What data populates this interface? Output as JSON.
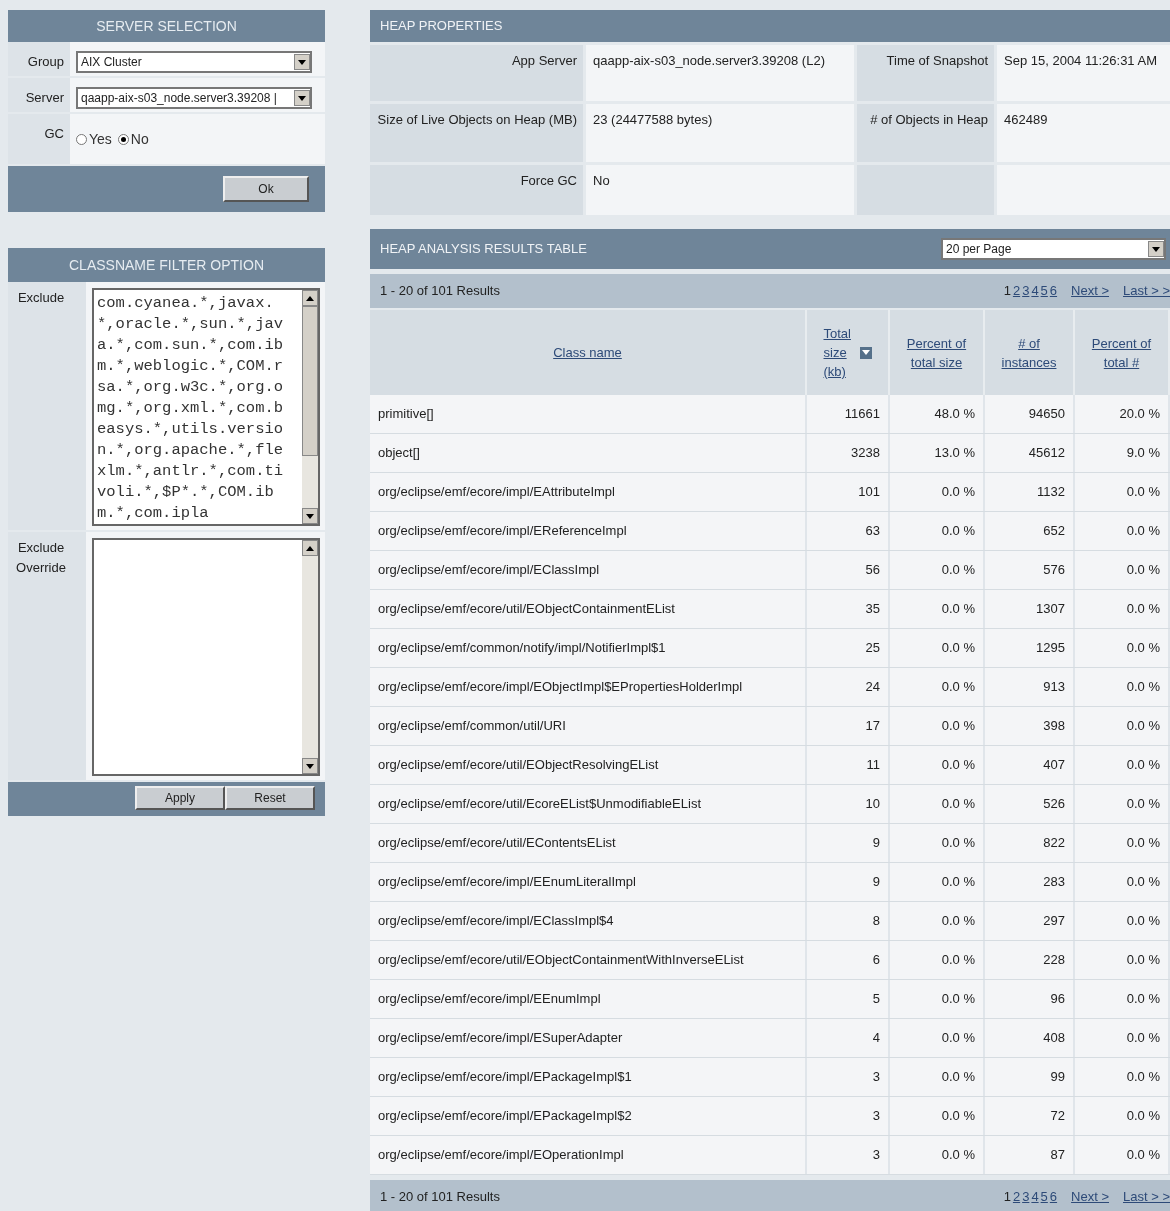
{
  "server_selection": {
    "title": "SERVER SELECTION",
    "group": {
      "label": "Group",
      "value": "AIX Cluster"
    },
    "server": {
      "label": "Server",
      "value": "qaapp-aix-s03_node.server3.39208 |"
    },
    "gc": {
      "label": "GC",
      "options": [
        {
          "label": "Yes",
          "selected": false
        },
        {
          "label": "No",
          "selected": true
        }
      ]
    },
    "ok_button": "Ok"
  },
  "classname_filter": {
    "title": "CLASSNAME FILTER OPTION",
    "exclude": {
      "label": "Exclude",
      "value": "com.cyanea.*,javax.*,oracle.*,sun.*,java.*,com.sun.*,com.ibm.*,weblogic.*,COM.rsa.*,org.w3c.*,org.omg.*,org.xml.*,com.beasys.*,utils.version.*,org.apache.*,flexlm.*,antlr.*,com.tivoli.*,$P*.*,COM.ibm.*,com.ipla"
    },
    "exclude_override": {
      "label": "Exclude Override"
    },
    "buttons": [
      "Apply",
      "Reset"
    ]
  },
  "heap_properties": {
    "title": "HEAP PROPERTIES",
    "rows": [
      [
        {
          "label": "App Server",
          "value": "qaapp-aix-s03_node.server3.39208 (L2)"
        },
        {
          "label": "Time of Snapshot",
          "value": "Sep 15, 2004 11:26:31 AM"
        }
      ],
      [
        {
          "label": "Size of Live Objects on Heap (MB)",
          "value": "23 (24477588 bytes)"
        },
        {
          "label": "# of Objects in Heap",
          "value": "462489"
        }
      ],
      [
        {
          "label": "Force GC",
          "value": "No"
        }
      ]
    ]
  },
  "results_table": {
    "title": "HEAP ANALYSIS RESULTS TABLE",
    "per_page": "20 per Page",
    "top_pager": {
      "summary": "1 - 20 of 101 Results",
      "pages": [
        {
          "label": "1",
          "selected": true
        },
        {
          "label": "2",
          "selected": false
        },
        {
          "label": "3",
          "selected": false
        },
        {
          "label": "4",
          "selected": false
        },
        {
          "label": "5",
          "selected": false
        },
        {
          "label": "6",
          "selected": false
        }
      ],
      "next": "Next >",
      "last": "Last > >"
    },
    "columns": [
      {
        "label": "Class name",
        "sorted": false
      },
      {
        "label": "Total size (kb)",
        "sorted": true
      },
      {
        "label": "Percent of total size",
        "sorted": false
      },
      {
        "label": "# of instances",
        "sorted": false
      },
      {
        "label": "Percent of total #",
        "sorted": false
      }
    ],
    "rows": [
      [
        "primitive[]",
        "11661",
        "48.0 %",
        "94650",
        "20.0 %"
      ],
      [
        "object[]",
        "3238",
        "13.0 %",
        "45612",
        "9.0 %"
      ],
      [
        "org/eclipse/emf/ecore/impl/EAttributeImpl",
        "101",
        "0.0 %",
        "1132",
        "0.0 %"
      ],
      [
        "org/eclipse/emf/ecore/impl/EReferenceImpl",
        "63",
        "0.0 %",
        "652",
        "0.0 %"
      ],
      [
        "org/eclipse/emf/ecore/impl/EClassImpl",
        "56",
        "0.0 %",
        "576",
        "0.0 %"
      ],
      [
        "org/eclipse/emf/ecore/util/EObjectContainmentEList",
        "35",
        "0.0 %",
        "1307",
        "0.0 %"
      ],
      [
        "org/eclipse/emf/common/notify/impl/NotifierImpl$1",
        "25",
        "0.0 %",
        "1295",
        "0.0 %"
      ],
      [
        "org/eclipse/emf/ecore/impl/EObjectImpl$EPropertiesHolderImpl",
        "24",
        "0.0 %",
        "913",
        "0.0 %"
      ],
      [
        "org/eclipse/emf/common/util/URI",
        "17",
        "0.0 %",
        "398",
        "0.0 %"
      ],
      [
        "org/eclipse/emf/ecore/util/EObjectResolvingEList",
        "11",
        "0.0 %",
        "407",
        "0.0 %"
      ],
      [
        "org/eclipse/emf/ecore/util/EcoreEList$UnmodifiableEList",
        "10",
        "0.0 %",
        "526",
        "0.0 %"
      ],
      [
        "org/eclipse/emf/ecore/util/EContentsEList",
        "9",
        "0.0 %",
        "822",
        "0.0 %"
      ],
      [
        "org/eclipse/emf/ecore/impl/EEnumLiteralImpl",
        "9",
        "0.0 %",
        "283",
        "0.0 %"
      ],
      [
        "org/eclipse/emf/ecore/impl/EClassImpl$4",
        "8",
        "0.0 %",
        "297",
        "0.0 %"
      ],
      [
        "org/eclipse/emf/ecore/util/EObjectContainmentWithInverseEList",
        "6",
        "0.0 %",
        "228",
        "0.0 %"
      ],
      [
        "org/eclipse/emf/ecore/impl/EEnumImpl",
        "5",
        "0.0 %",
        "96",
        "0.0 %"
      ],
      [
        "org/eclipse/emf/ecore/impl/ESuperAdapter",
        "4",
        "0.0 %",
        "408",
        "0.0 %"
      ],
      [
        "org/eclipse/emf/ecore/impl/EPackageImpl$1",
        "3",
        "0.0 %",
        "99",
        "0.0 %"
      ],
      [
        "org/eclipse/emf/ecore/impl/EPackageImpl$2",
        "3",
        "0.0 %",
        "72",
        "0.0 %"
      ],
      [
        "org/eclipse/emf/ecore/impl/EOperationImpl",
        "3",
        "0.0 %",
        "87",
        "0.0 %"
      ]
    ],
    "bottom_pager": {
      "summary": "1 - 20 of 101 Results",
      "pages": [
        {
          "label": "1",
          "selected": true
        },
        {
          "label": "2",
          "selected": false
        },
        {
          "label": "3",
          "selected": false
        },
        {
          "label": "4",
          "selected": false
        },
        {
          "label": "5",
          "selected": false
        },
        {
          "label": "6",
          "selected": false
        }
      ],
      "next": "Next >",
      "last": "Last > >"
    }
  }
}
